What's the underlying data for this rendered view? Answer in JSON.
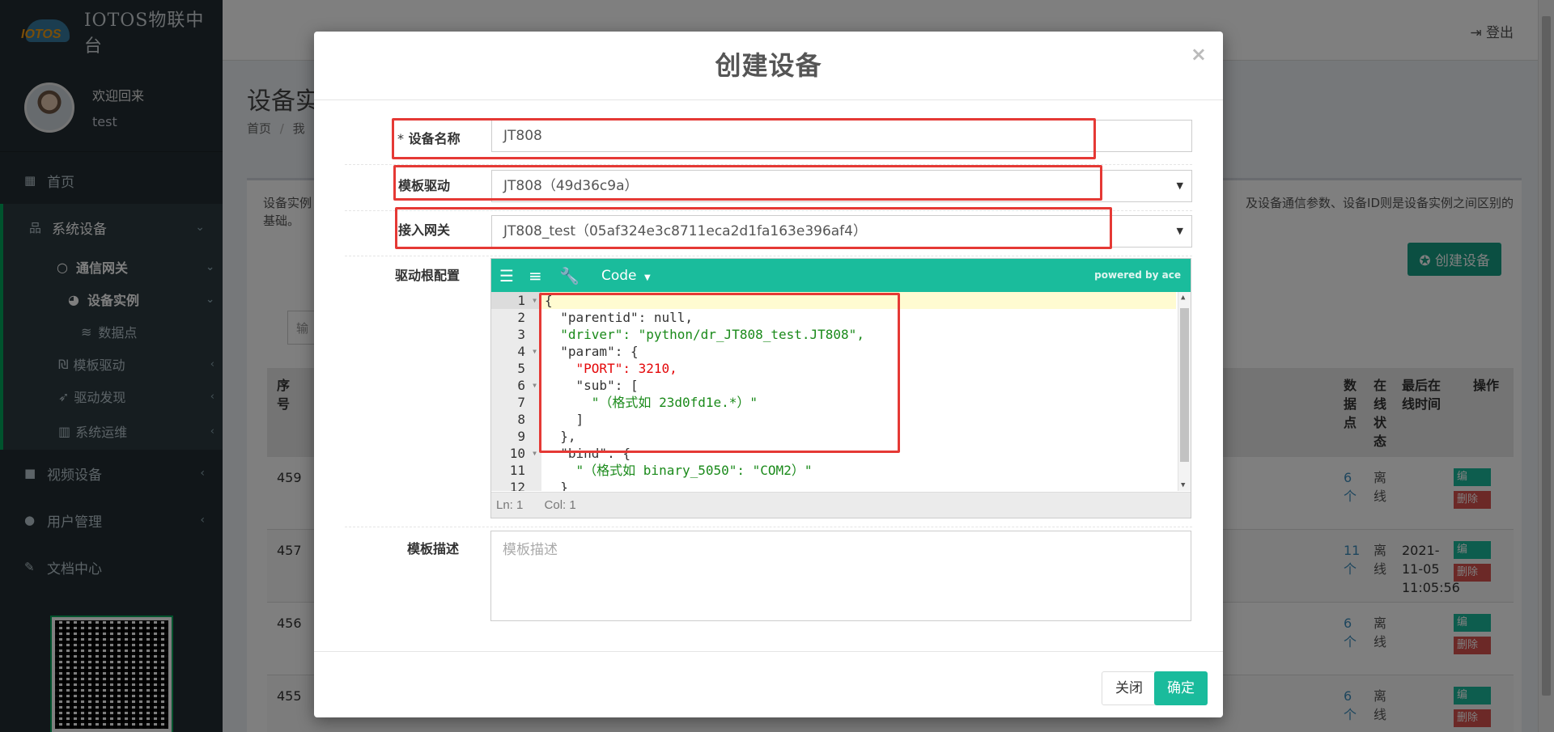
{
  "app": {
    "logo_text": "IOTOS",
    "title": "IOTOS物联中台"
  },
  "user": {
    "welcome": "欢迎回来",
    "name": "test"
  },
  "sidebar": {
    "home": "首页",
    "system_devices": "系统设备",
    "gateway": "通信网关",
    "device_instance": "设备实例",
    "data_points": "数据点",
    "template_driver": "模板驱动",
    "driver_discovery": "驱动发现",
    "system_ops": "系统运维",
    "video_devices": "视频设备",
    "user_mgmt": "用户管理",
    "docs": "文档中心"
  },
  "header": {
    "logout": "登出"
  },
  "page": {
    "title": "设备实",
    "breadcrumb_home": "首页",
    "breadcrumb_sep": "/",
    "breadcrumb_cur": "我",
    "desc_left": "设备实例",
    "desc_left2": "基础。",
    "desc_right": "及设备通信参数、设备ID则是设备实例之间区别的",
    "create_button": "创建设备",
    "search_placeholder": "输"
  },
  "table": {
    "col_seq": "序号",
    "col_points": "数据点",
    "col_online": "在线状态",
    "col_last": "最后在线时间",
    "col_ops": "操作",
    "rows": [
      {
        "id": "459",
        "points": "6个",
        "state": "离线",
        "last": ""
      },
      {
        "id": "457",
        "points": "11个",
        "state": "离线",
        "last": "2021-11-05 11:05:56"
      },
      {
        "id": "456",
        "points": "6个",
        "state": "离线",
        "last": ""
      },
      {
        "id": "455",
        "points": "6个",
        "state": "离线",
        "last": ""
      }
    ],
    "edit_label": "编",
    "delete_label": "删除"
  },
  "modal": {
    "title": "创建设备",
    "close_icon": "×",
    "device_name_label": "设备名称",
    "required_mark": "*",
    "device_name_value": "JT808",
    "template_driver_label": "模板驱动",
    "template_driver_value": "JT808（49d36c9a）",
    "gateway_label": "接入网关",
    "gateway_value": "JT808_test（05af324e3c8711eca2d1fa163e396af4）",
    "driver_config_label": "驱动根配置",
    "editor": {
      "mode": "Code",
      "powered": "powered by ace",
      "status_ln": "Ln: 1",
      "status_col": "Col: 1",
      "lines": [
        "{",
        "  \"parentid\": null,",
        "  \"driver\": \"python/dr_JT808_test.JT808\",",
        "  \"param\": {",
        "    \"PORT\": 3210,",
        "    \"sub\": [",
        "      \"（格式如 23d0fd1e.*）\"",
        "    ]",
        "  },",
        "  \"bind\": {",
        "    \"（格式如 binary_5050\": \"COM2）\"",
        "  }"
      ]
    },
    "template_desc_label": "模板描述",
    "template_desc_placeholder": "模板描述",
    "close_button": "关闭",
    "ok_button": "确定"
  },
  "colors": {
    "accent": "#1abb9c",
    "highlight": "#e53935",
    "sidebar": "#222d32"
  }
}
